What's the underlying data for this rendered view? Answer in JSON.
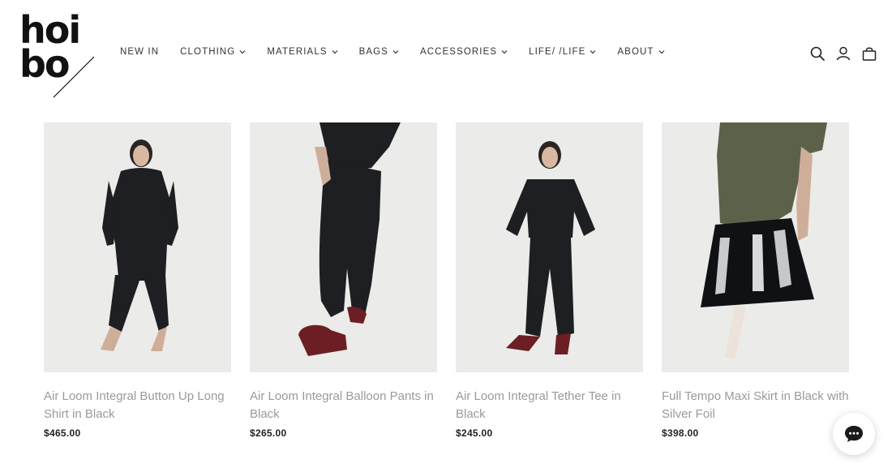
{
  "logo": {
    "line1": "hoi",
    "line2": "bo"
  },
  "nav": {
    "items": [
      {
        "label": "NEW IN",
        "has_menu": false
      },
      {
        "label": "CLOTHING",
        "has_menu": true
      },
      {
        "label": "MATERIALS",
        "has_menu": true
      },
      {
        "label": "BAGS",
        "has_menu": true
      },
      {
        "label": "ACCESSORIES",
        "has_menu": true
      },
      {
        "label": "LIFE/ /LIFE",
        "has_menu": true
      },
      {
        "label": "ABOUT",
        "has_menu": true
      }
    ]
  },
  "header_icons": [
    "search-icon",
    "account-icon",
    "cart-bag-icon"
  ],
  "products": [
    {
      "title": "Air Loom Integral Button Up Long Shirt in Black",
      "price": "$465.00"
    },
    {
      "title": "Air Loom Integral Balloon Pants in Black",
      "price": "$265.00"
    },
    {
      "title": "Air Loom Integral Tether Tee in Black",
      "price": "$245.00"
    },
    {
      "title": "Full Tempo Maxi Skirt in Black with Silver Foil",
      "price": "$398.00"
    }
  ],
  "chat": {
    "icon": "chat-bubble-icon"
  },
  "colors": {
    "text": "#1a1a1a",
    "title_grey": "#9a9a9a",
    "photo_bg": "#ebebe9",
    "garment_black": "#1d1f22",
    "skirt_top_green": "#5b6249",
    "shoe_burgundy": "#6b1f24"
  }
}
